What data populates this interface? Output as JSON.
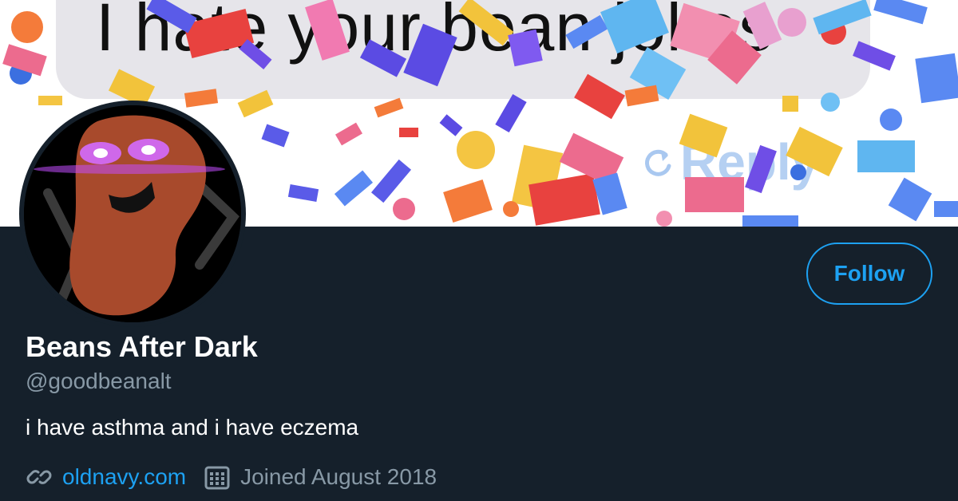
{
  "banner": {
    "bubble_text": "I hate your bean jokes",
    "reply_text": "Reply"
  },
  "profile": {
    "display_name": "Beans After Dark",
    "handle": "@goodbeanalt",
    "bio": "i have asthma and i have eczema",
    "website": "oldnavy.com",
    "joined": "Joined August 2018"
  },
  "actions": {
    "follow_label": "Follow"
  },
  "icons": {
    "website": "link-icon",
    "joined": "calendar-icon",
    "reply": "reply-icon"
  },
  "colors": {
    "background": "#15202b",
    "accent": "#1da1f2",
    "secondary_text": "#8899a6",
    "primary_text": "#ffffff"
  }
}
